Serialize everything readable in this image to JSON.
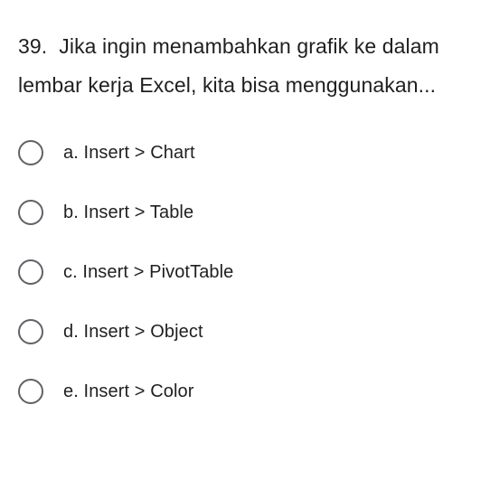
{
  "question": {
    "number": "39.",
    "text": "Jika ingin menambahkan grafik ke dalam lembar kerja Excel, kita bisa menggunakan..."
  },
  "options": [
    {
      "label": "a. Insert > Chart"
    },
    {
      "label": "b. Insert > Table"
    },
    {
      "label": "c. Insert > PivotTable"
    },
    {
      "label": "d. Insert > Object"
    },
    {
      "label": "e. Insert > Color"
    }
  ]
}
